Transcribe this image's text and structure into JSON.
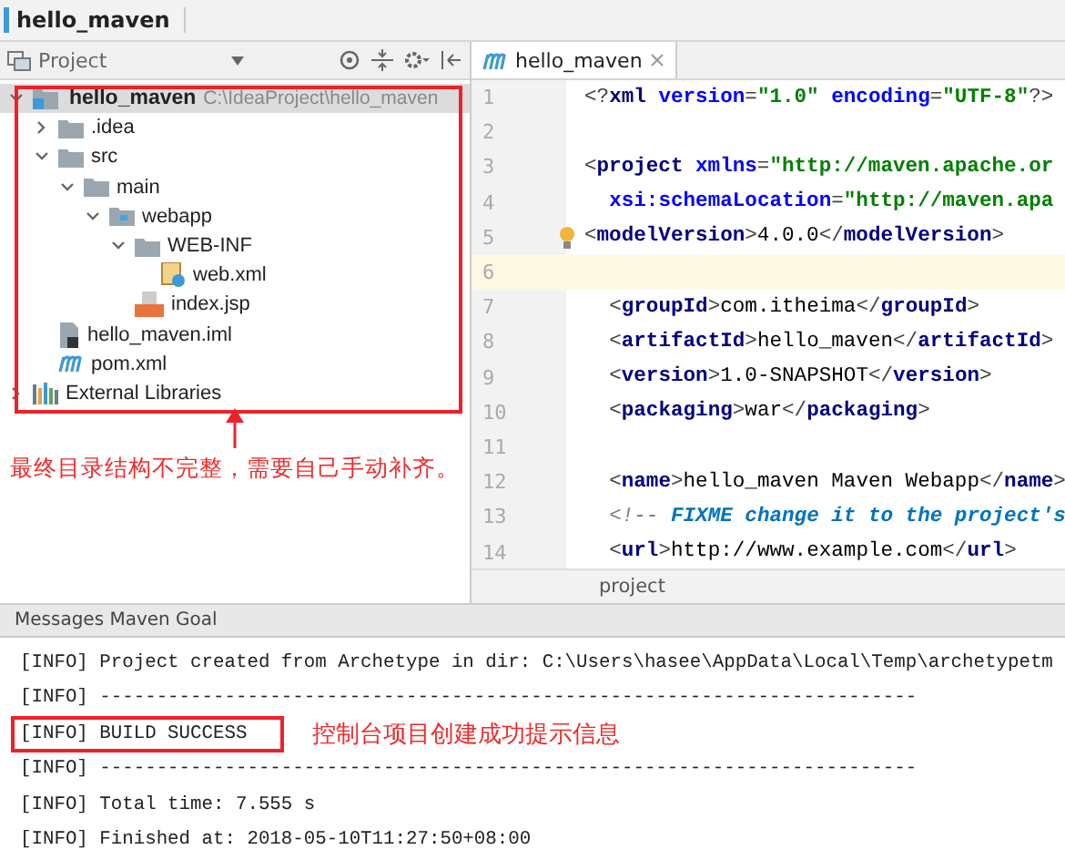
{
  "breadcrumb": {
    "label": "hello_maven"
  },
  "project_panel": {
    "title": "Project",
    "tree": [
      {
        "label": "hello_maven",
        "path": "C:\\IdeaProject\\hello_maven",
        "kind": "module",
        "expanded": true,
        "selected": true,
        "children": [
          {
            "label": ".idea",
            "kind": "folder",
            "expanded": false,
            "selected": false
          },
          {
            "label": "src",
            "kind": "folder",
            "expanded": true,
            "selected": false,
            "children": [
              {
                "label": "main",
                "kind": "folder",
                "expanded": true,
                "selected": false,
                "children": [
                  {
                    "label": "webapp",
                    "kind": "web-folder",
                    "expanded": true,
                    "selected": false,
                    "children": [
                      {
                        "label": "WEB-INF",
                        "kind": "folder",
                        "expanded": true,
                        "selected": false,
                        "children": [
                          {
                            "label": "web.xml",
                            "kind": "xml",
                            "selected": false
                          }
                        ]
                      },
                      {
                        "label": "index.jsp",
                        "kind": "jsp",
                        "selected": false
                      }
                    ]
                  }
                ]
              }
            ]
          },
          {
            "label": "hello_maven.iml",
            "kind": "iml",
            "selected": false
          },
          {
            "label": "pom.xml",
            "kind": "maven",
            "selected": false
          }
        ]
      },
      {
        "label": "External Libraries",
        "kind": "libraries",
        "expanded": false,
        "selected": false
      }
    ],
    "note": "最终目录结构不完整，需要自己手动补齐。"
  },
  "editor": {
    "tab": {
      "label": "hello_maven",
      "selected": true
    },
    "lines": [
      {
        "number": "1",
        "current": false,
        "hint": false,
        "indented": false,
        "segments": [
          {
            "kind": "punct",
            "text": "<?"
          },
          {
            "kind": "tag",
            "text": "xml "
          },
          {
            "kind": "attr",
            "text": "version"
          },
          {
            "kind": "punct",
            "text": "="
          },
          {
            "kind": "value",
            "text": "\"1.0\" "
          },
          {
            "kind": "attr",
            "text": "encoding"
          },
          {
            "kind": "punct",
            "text": "="
          },
          {
            "kind": "value",
            "text": "\"UTF-8\""
          },
          {
            "kind": "punct",
            "text": "?>"
          }
        ]
      },
      {
        "number": "2",
        "current": false,
        "hint": false
      },
      {
        "number": "3",
        "current": false,
        "hint": false,
        "indented": false,
        "segments": [
          {
            "kind": "punct",
            "text": "<"
          },
          {
            "kind": "tag",
            "text": "project "
          },
          {
            "kind": "attr",
            "text": "xmlns"
          },
          {
            "kind": "punct",
            "text": "="
          },
          {
            "kind": "value",
            "text": "\"http://maven.apache.or"
          }
        ]
      },
      {
        "number": "4",
        "current": false,
        "hint": false,
        "indented": true,
        "segments": [
          {
            "kind": "attr",
            "text": "xsi:schemaLocation"
          },
          {
            "kind": "punct",
            "text": "="
          },
          {
            "kind": "value",
            "text": "\"http://maven.apa"
          }
        ]
      },
      {
        "number": "5",
        "current": false,
        "hint": true,
        "indented": false,
        "segments": [
          {
            "kind": "punct",
            "text": "<"
          },
          {
            "kind": "tag",
            "text": "modelVersion"
          },
          {
            "kind": "punct",
            "text": ">"
          },
          {
            "kind": "text",
            "text": "4.0.0"
          },
          {
            "kind": "punct",
            "text": "</"
          },
          {
            "kind": "tag",
            "text": "modelVersion"
          },
          {
            "kind": "punct",
            "text": ">"
          }
        ]
      },
      {
        "number": "6",
        "current": true,
        "hint": false
      },
      {
        "number": "7",
        "current": false,
        "hint": false,
        "indented": true,
        "segments": [
          {
            "kind": "punct",
            "text": "<"
          },
          {
            "kind": "tag",
            "text": "groupId"
          },
          {
            "kind": "punct",
            "text": ">"
          },
          {
            "kind": "text",
            "text": "com.itheima"
          },
          {
            "kind": "punct",
            "text": "</"
          },
          {
            "kind": "tag",
            "text": "groupId"
          },
          {
            "kind": "punct",
            "text": ">"
          }
        ]
      },
      {
        "number": "8",
        "current": false,
        "hint": false,
        "indented": true,
        "segments": [
          {
            "kind": "punct",
            "text": "<"
          },
          {
            "kind": "tag",
            "text": "artifactId"
          },
          {
            "kind": "punct",
            "text": ">"
          },
          {
            "kind": "text",
            "text": "hello_maven"
          },
          {
            "kind": "punct",
            "text": "</"
          },
          {
            "kind": "tag",
            "text": "artifactId"
          },
          {
            "kind": "punct",
            "text": ">"
          }
        ]
      },
      {
        "number": "9",
        "current": false,
        "hint": false,
        "indented": true,
        "segments": [
          {
            "kind": "punct",
            "text": "<"
          },
          {
            "kind": "tag",
            "text": "version"
          },
          {
            "kind": "punct",
            "text": ">"
          },
          {
            "kind": "text",
            "text": "1.0-SNAPSHOT"
          },
          {
            "kind": "punct",
            "text": "</"
          },
          {
            "kind": "tag",
            "text": "version"
          },
          {
            "kind": "punct",
            "text": ">"
          }
        ]
      },
      {
        "number": "10",
        "current": false,
        "hint": false,
        "indented": true,
        "segments": [
          {
            "kind": "punct",
            "text": "<"
          },
          {
            "kind": "tag",
            "text": "packaging"
          },
          {
            "kind": "punct",
            "text": ">"
          },
          {
            "kind": "text",
            "text": "war"
          },
          {
            "kind": "punct",
            "text": "</"
          },
          {
            "kind": "tag",
            "text": "packaging"
          },
          {
            "kind": "punct",
            "text": ">"
          }
        ]
      },
      {
        "number": "11",
        "current": false,
        "hint": false
      },
      {
        "number": "12",
        "current": false,
        "hint": false,
        "indented": true,
        "segments": [
          {
            "kind": "punct",
            "text": "<"
          },
          {
            "kind": "tag",
            "text": "name"
          },
          {
            "kind": "punct",
            "text": ">"
          },
          {
            "kind": "text",
            "text": "hello_maven Maven Webapp"
          },
          {
            "kind": "punct",
            "text": "</"
          },
          {
            "kind": "tag",
            "text": "name"
          },
          {
            "kind": "punct",
            "text": ">"
          }
        ]
      },
      {
        "number": "13",
        "current": false,
        "hint": false,
        "indented": true,
        "segments": [
          {
            "kind": "comment",
            "text": "<!-- "
          },
          {
            "kind": "todo",
            "text": "FIXME change it to the project's"
          }
        ]
      },
      {
        "number": "14",
        "current": false,
        "hint": false,
        "indented": true,
        "segments": [
          {
            "kind": "punct",
            "text": "<"
          },
          {
            "kind": "tag",
            "text": "url"
          },
          {
            "kind": "punct",
            "text": ">"
          },
          {
            "kind": "text",
            "text": "http://www.example.com"
          },
          {
            "kind": "punct",
            "text": "</"
          },
          {
            "kind": "tag",
            "text": "url"
          },
          {
            "kind": "punct",
            "text": ">"
          }
        ]
      }
    ],
    "footer": "project"
  },
  "console": {
    "title": "Messages Maven Goal",
    "lines": [
      {
        "text": "[INFO] Project created from Archetype in dir: C:\\Users\\hasee\\AppData\\Local\\Temp\\archetypetm",
        "highlighted": false
      },
      {
        "text": "[INFO] ------------------------------------------------------------------------",
        "highlighted": false
      },
      {
        "text": "[INFO] BUILD SUCCESS",
        "highlighted": true,
        "note": "控制台项目创建成功提示信息"
      },
      {
        "text": "[INFO] ------------------------------------------------------------------------",
        "highlighted": false
      },
      {
        "text": "[INFO] Total time: 7.555 s",
        "highlighted": false
      },
      {
        "text": "[INFO] Finished at: 2018-05-10T11:27:50+08:00",
        "highlighted": false
      }
    ]
  }
}
